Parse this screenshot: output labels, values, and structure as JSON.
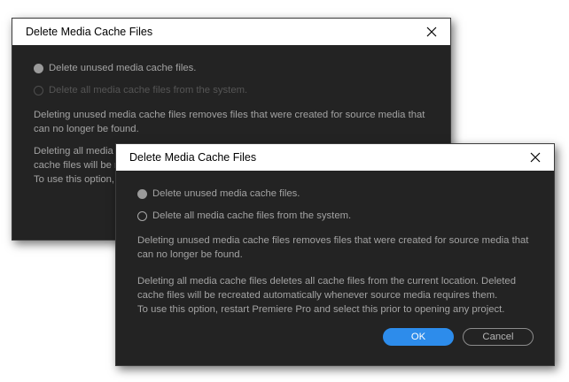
{
  "dialogs": [
    {
      "title": "Delete Media Cache Files",
      "options": [
        {
          "label": "Delete unused media cache files.",
          "selected": true
        },
        {
          "label": "Delete all media cache files from the system.",
          "enabled": false
        }
      ],
      "paragraph1": [
        "Deleting unused media cache files removes files that were created for source media that",
        "can no longer be found."
      ],
      "paragraph2": [
        "Deleting all media",
        "cache files will be r",
        "To use this option, r"
      ]
    },
    {
      "title": "Delete Media Cache Files",
      "options": [
        {
          "label": "Delete unused media cache files.",
          "selected": true
        },
        {
          "label": "Delete all media cache files from the system.",
          "selected": false
        }
      ],
      "paragraph1": [
        "Deleting unused media cache files removes files that were created for source media that",
        "can no longer be found."
      ],
      "paragraph2": [
        "Deleting all media cache files deletes all cache files from the current location. Deleted",
        "cache files will be recreated automatically whenever source media requires them.",
        "To use this option, restart Premiere Pro and select this prior to opening any project."
      ],
      "buttons": {
        "ok": "OK",
        "cancel": "Cancel"
      }
    }
  ],
  "colors": {
    "dialog_bg": "#232323",
    "titlebar_bg": "#ffffff",
    "text": "#a3a3a3",
    "accent": "#2d8ceb"
  }
}
